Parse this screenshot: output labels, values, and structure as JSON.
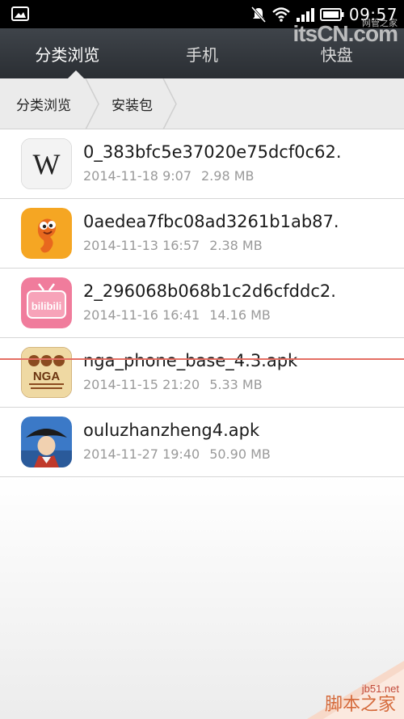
{
  "status_bar": {
    "time": "09:57",
    "icons": [
      "gallery-icon",
      "mute-icon",
      "wifi-icon",
      "signal-icon",
      "battery-icon"
    ]
  },
  "watermark_top": {
    "big": "itsCN.com",
    "small": "网管之家"
  },
  "tabs": [
    {
      "label": "分类浏览",
      "active": true
    },
    {
      "label": "手机",
      "active": false
    },
    {
      "label": "快盘",
      "active": false
    }
  ],
  "breadcrumb": [
    "分类浏览",
    "安装包"
  ],
  "files": [
    {
      "name": "0_383bfc5e37020e75dcf0c62.",
      "date": "2014-11-18 9:07",
      "size": "2.98 MB",
      "icon": "wikipedia-icon"
    },
    {
      "name": "0aedea7fbc08ad3261b1ab87.",
      "date": "2014-11-13 16:57",
      "size": "2.38 MB",
      "icon": "cartoon-app-icon"
    },
    {
      "name": "2_296068b068b1c2d6cfddc2.",
      "date": "2014-11-16 16:41",
      "size": "14.16 MB",
      "icon": "bilibili-icon"
    },
    {
      "name": "nga_phone_base_4.3.apk",
      "date": "2014-11-15 21:20",
      "size": "5.33 MB",
      "icon": "nga-icon"
    },
    {
      "name": "ouluzhanzheng4.apk",
      "date": "2014-11-27 19:40",
      "size": "50.90 MB",
      "icon": "napoleon-game-icon"
    }
  ],
  "watermark_bottom": {
    "line1": "jb51.net",
    "line2": "脚本之家"
  },
  "colors": {
    "tab_bar": "#2f3338",
    "breadcrumb_bg": "#ebebeb",
    "meta_text": "#9a9a9a",
    "red_line": "#e46f64"
  }
}
